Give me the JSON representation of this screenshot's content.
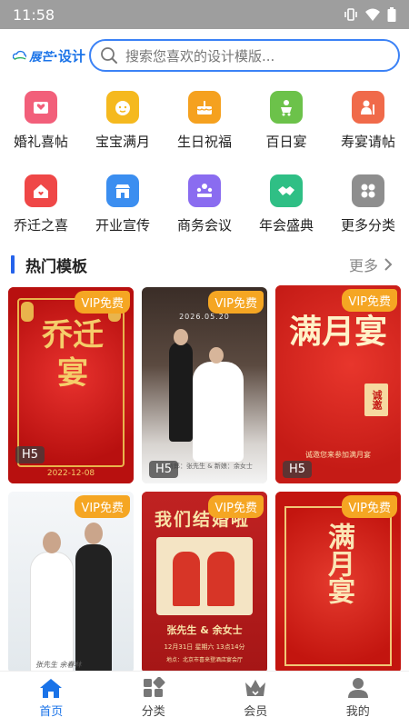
{
  "status_bar": {
    "time": "11:58"
  },
  "header": {
    "logo_text": "展芒",
    "logo_suffix": "·设计",
    "search_placeholder": "搜索您喜欢的设计模版..."
  },
  "categories": [
    {
      "label": "婚礼喜帖",
      "icon": "wedding-invite-icon",
      "color": "#f25f7a"
    },
    {
      "label": "宝宝满月",
      "icon": "baby-face-icon",
      "color": "#f5b91f"
    },
    {
      "label": "生日祝福",
      "icon": "birthday-cake-icon",
      "color": "#f5a11f"
    },
    {
      "label": "百日宴",
      "icon": "baby-stroller-icon",
      "color": "#6cc24a"
    },
    {
      "label": "寿宴请帖",
      "icon": "elder-icon",
      "color": "#f06a4a"
    },
    {
      "label": "乔迁之喜",
      "icon": "house-icon",
      "color": "#ef4747"
    },
    {
      "label": "开业宣传",
      "icon": "shop-icon",
      "color": "#3b8ef0"
    },
    {
      "label": "商务会议",
      "icon": "meeting-icon",
      "color": "#8a6cf0"
    },
    {
      "label": "年会盛典",
      "icon": "handshake-icon",
      "color": "#2fbf85"
    },
    {
      "label": "更多分类",
      "icon": "more-grid-icon",
      "color": "#8e8e8e"
    }
  ],
  "section": {
    "title": "热门模板",
    "more": "更多"
  },
  "badges": {
    "vip": "VIP免费",
    "h5": "H5"
  },
  "templates": [
    {
      "main": "乔迁宴",
      "date": "2022-12-08"
    },
    {
      "date": "2026.05.20",
      "caption": "新郎：张先生 & 新娘：余女士"
    },
    {
      "main": "满月宴",
      "seal": "诚邀",
      "caption": "诚邀您来参加满月宴"
    },
    {
      "caption": "张先生 余春林"
    },
    {
      "title": "我们结婚啦",
      "couple": "张先生 & 余女士",
      "info": "12月31日 星期六 13点14分",
      "place": "地点：北京市喜来登酒店宴会厅"
    },
    {
      "main": "满月宴"
    }
  ],
  "tabs": [
    {
      "label": "首页"
    },
    {
      "label": "分类"
    },
    {
      "label": "会员"
    },
    {
      "label": "我的"
    }
  ],
  "colors": {
    "accent": "#1a73e8",
    "vip": "#f5a623",
    "festive_red": "#c8151b"
  }
}
